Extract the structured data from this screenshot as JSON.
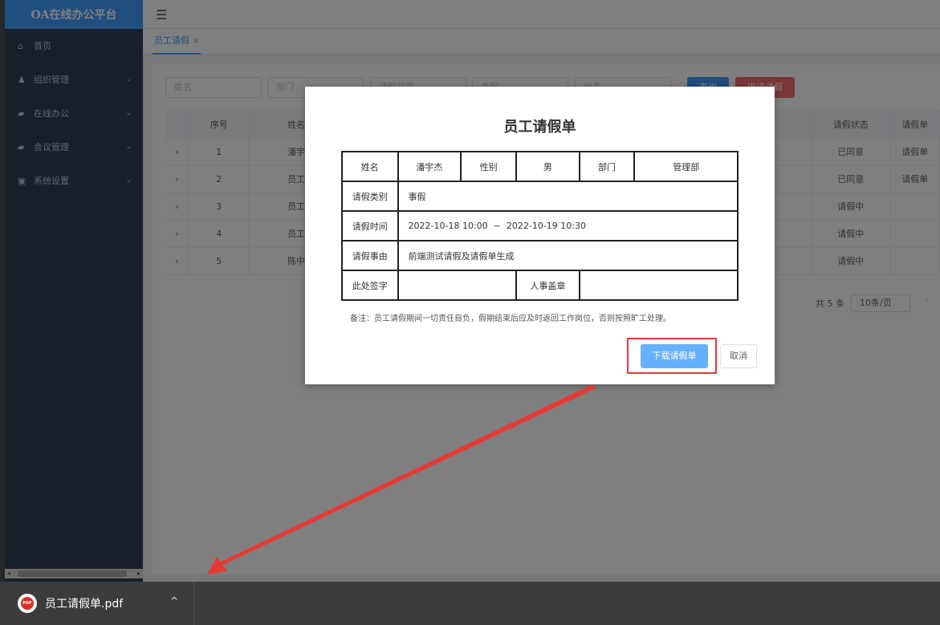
{
  "app": {
    "brand": "OA在线办公平台",
    "hamburger": "☰"
  },
  "sidebar": {
    "items": [
      {
        "label": "首页",
        "icon": "home-icon",
        "glyph": "⌂",
        "has_children": false
      },
      {
        "label": "组织管理",
        "icon": "org-icon",
        "glyph": "♟",
        "has_children": true
      },
      {
        "label": "在线办公",
        "icon": "office-icon",
        "glyph": "▰",
        "has_children": true
      },
      {
        "label": "会议管理",
        "icon": "meeting-icon",
        "glyph": "▰",
        "has_children": true
      },
      {
        "label": "系统设置",
        "icon": "settings-icon",
        "glyph": "▣",
        "has_children": true
      }
    ]
  },
  "tabs": [
    {
      "label": "员工请假",
      "close": "×"
    }
  ],
  "filters": {
    "name_placeholder": "姓名",
    "dept_placeholder": "部门",
    "date_placeholder": "请假日期",
    "type_placeholder": "类别",
    "status_placeholder": "状态",
    "query_label": "查询",
    "add_label": "申请请假"
  },
  "table": {
    "columns": [
      "",
      "序号",
      "姓名",
      "请假状态",
      "请假单"
    ],
    "rows": [
      {
        "expand": "›",
        "index": "1",
        "name": "潘宇",
        "status": "已同意",
        "status_type": "agree",
        "form": "请假单"
      },
      {
        "expand": "›",
        "index": "2",
        "name": "员工",
        "status": "已同意",
        "status_type": "agree",
        "form": "请假单"
      },
      {
        "expand": "›",
        "index": "3",
        "name": "员工",
        "status": "请假中",
        "status_type": "pending",
        "form": ""
      },
      {
        "expand": "›",
        "index": "4",
        "name": "员工",
        "status": "请假中",
        "status_type": "pending",
        "form": ""
      },
      {
        "expand": "›",
        "index": "5",
        "name": "陈中",
        "status": "请假中",
        "status_type": "pending",
        "form": ""
      }
    ]
  },
  "pager": {
    "total": "共 5 条",
    "page_size": "10条/页",
    "prev": "‹"
  },
  "dialog": {
    "title": "员工请假单",
    "labels": {
      "name": "姓名",
      "gender": "性别",
      "dept": "部门",
      "type": "请假类别",
      "time": "请假时间",
      "reason": "请假事由",
      "signature": "此处签字",
      "hr_seal": "人事盖章"
    },
    "values": {
      "name": "潘宇杰",
      "gender": "男",
      "dept": "管理部",
      "type": "事假",
      "time": "2022-10-18 10:00  ~  2022-10-19 10:30",
      "reason": "前端测试请假及请假单生成"
    },
    "remark": "备注：员工请假期间一切责任自负，假期结束后应及时返回工作岗位，否则按照旷工处理。",
    "download_label": "下载请假单",
    "cancel_label": "取消"
  },
  "download_bar": {
    "file_name": "员工请假单.pdf",
    "badge": "PDF",
    "chevron": "^"
  },
  "colors": {
    "accent": "#409eff",
    "danger": "#f56c6c",
    "success": "#67c23a",
    "warning": "#e6a23c",
    "annotation_red": "#e53935"
  }
}
